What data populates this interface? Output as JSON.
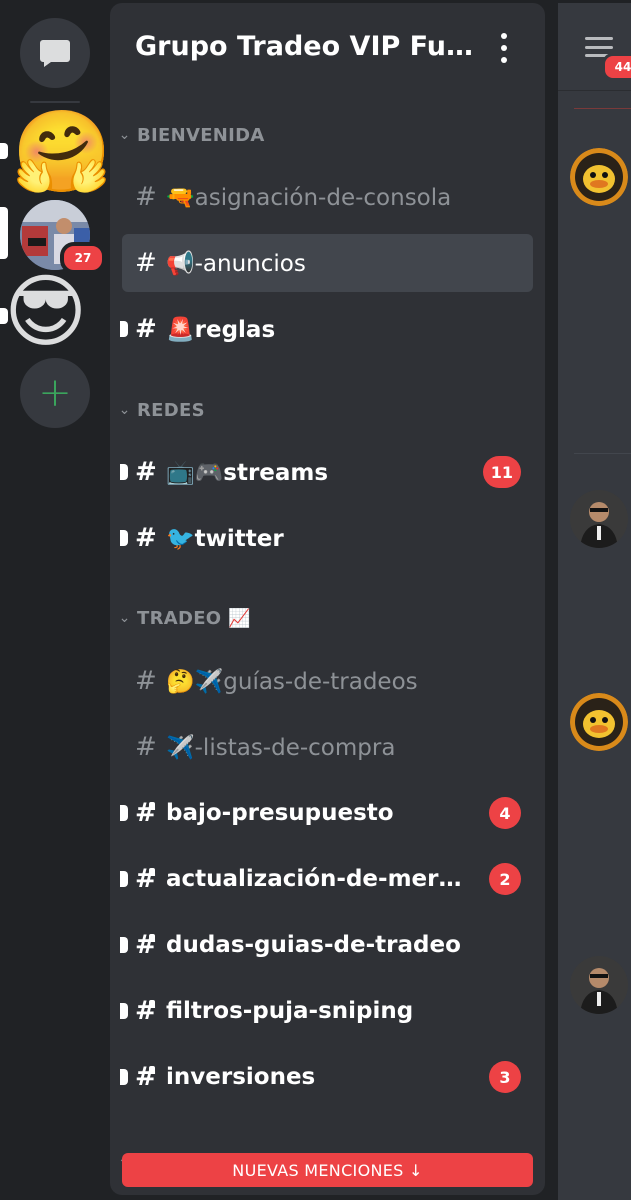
{
  "guilds": {
    "dm_icon": "chat-bubble-icon",
    "server2_badge": "27",
    "emoji_hug": "🤗",
    "emoji_cool": "😎",
    "add_server_label": "+"
  },
  "server": {
    "name": "Grupo Tradeo VIP FutAr..."
  },
  "categories": [
    {
      "label": "BIENVENIDA"
    },
    {
      "label": "REDES"
    },
    {
      "label": "TRADEO 📈"
    }
  ],
  "channels": [
    {
      "name": "🔫asignación-de-consola"
    },
    {
      "name": "📢-anuncios"
    },
    {
      "name": "🚨reglas"
    },
    {
      "name": "📺🎮streams",
      "badge": "11"
    },
    {
      "name": "🐦twitter"
    },
    {
      "name": "🤔✈️guías-de-tradeos"
    },
    {
      "name": "✈️-listas-de-compra"
    },
    {
      "name": "bajo-presupuesto",
      "badge": "4"
    },
    {
      "name": "actualización-de-merc...",
      "badge": "2"
    },
    {
      "name": "dudas-guias-de-tradeo"
    },
    {
      "name": "filtros-puja-sniping"
    },
    {
      "name": "inversiones",
      "badge": "3"
    }
  ],
  "mentions_bar": {
    "label": "NUEVAS MENCIONES ↓"
  },
  "peek": {
    "member_badge": "44"
  },
  "colors": {
    "accent_red": "#ed4245",
    "sidebar_bg": "#2f3136",
    "rail_bg": "#202225",
    "green": "#3ba55d"
  }
}
